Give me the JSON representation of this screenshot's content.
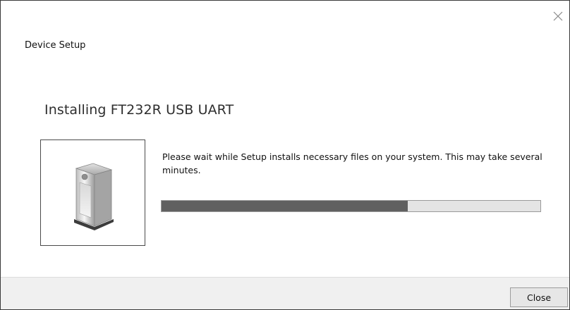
{
  "window": {
    "title": "Device Setup",
    "close_icon": "close-x-icon"
  },
  "main": {
    "heading": "Installing FT232R USB UART",
    "device_icon": "device-tower-icon",
    "message": "Please wait while Setup installs necessary files on your system. This may take several minutes.",
    "progress_percent": 65
  },
  "footer": {
    "close_label": "Close"
  },
  "colors": {
    "progress_fill": "#606060",
    "progress_track": "#e4e4e4",
    "footer_bg": "#f0f0f0"
  }
}
